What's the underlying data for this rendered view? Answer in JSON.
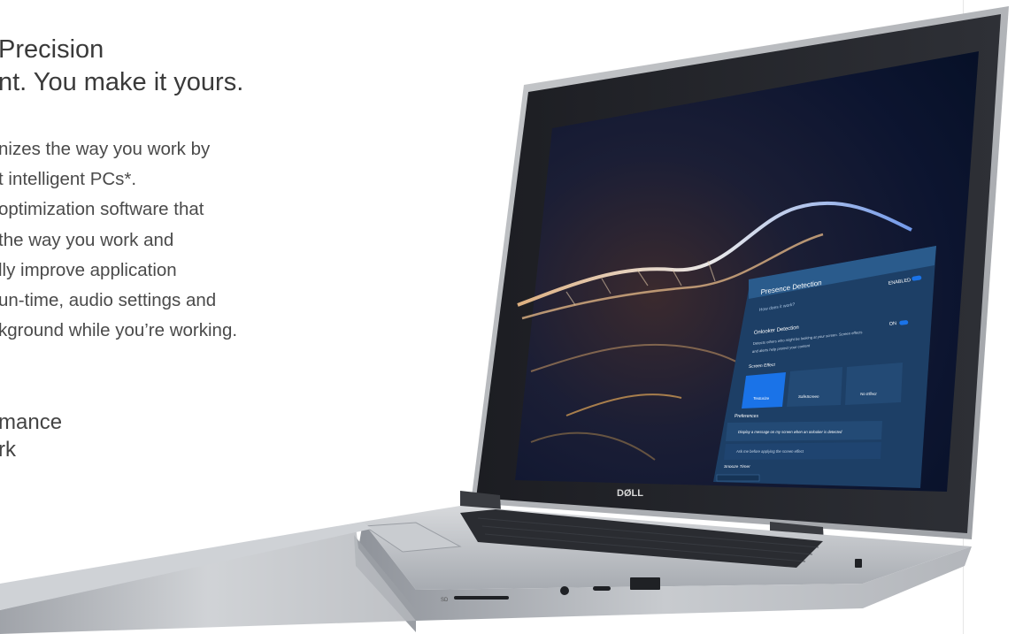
{
  "copy": {
    "headline_line1": "Precision",
    "headline_line2": "nt. You make it yours.",
    "body_lines": [
      "nizes the way you work by",
      "t intelligent PCs*.",
      "optimization software that",
      "the way you work and",
      "lly improve application",
      "un-time, audio settings and",
      "kground while you’re working."
    ],
    "sub_line1": "mance",
    "sub_line2": "rk"
  },
  "screen_app": {
    "title": "Presence Detection",
    "help_link": "How does it work?",
    "enabled_label": "ENABLED",
    "onlooker_title": "Onlooker Detection",
    "onlooker_state": "ON",
    "onlooker_desc_line1": "Detects others who might be looking at your screen. Screen effects",
    "onlooker_desc_line2": "and alerts help protect your content",
    "screen_effect_label": "Screen Effect",
    "effects": [
      "Texturize",
      "SafeScreen",
      "No Effect"
    ],
    "preferences_label": "Preferences",
    "pref1": "Display a message on my screen when an onlooker is detected",
    "pref2": "Ask me before applying the screen effect",
    "snooze_label": "Snooze Timer"
  },
  "brand_logo": "DØLL",
  "ports": {
    "sd_label": "SD"
  },
  "colors": {
    "app_panel": "#1d3f66",
    "accent": "#1a73e8",
    "chassis": "#b8bcc2"
  }
}
